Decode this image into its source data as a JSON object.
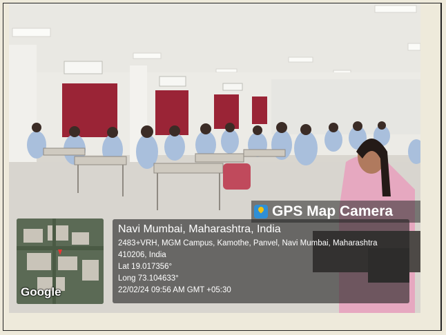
{
  "stamp": {
    "app_name": "GPS Map Camera",
    "location_title": "Navi Mumbai, Maharashtra, India",
    "address_line1": "2483+VRH, MGM Campus, Kamothe, Panvel, Navi Mumbai, Maharashtra",
    "address_line2": "410206, India",
    "latitude": "Lat 19.017356°",
    "longitude": "Long 73.104633°",
    "datetime": "22/02/24 09:56 AM GMT +05:30"
  },
  "map": {
    "provider_label": "Google"
  },
  "colors": {
    "page_background": "#eeeadb",
    "uniform_shirt": "#a9bfdc",
    "curtain": "#9a2436",
    "overlay": "#232323"
  }
}
